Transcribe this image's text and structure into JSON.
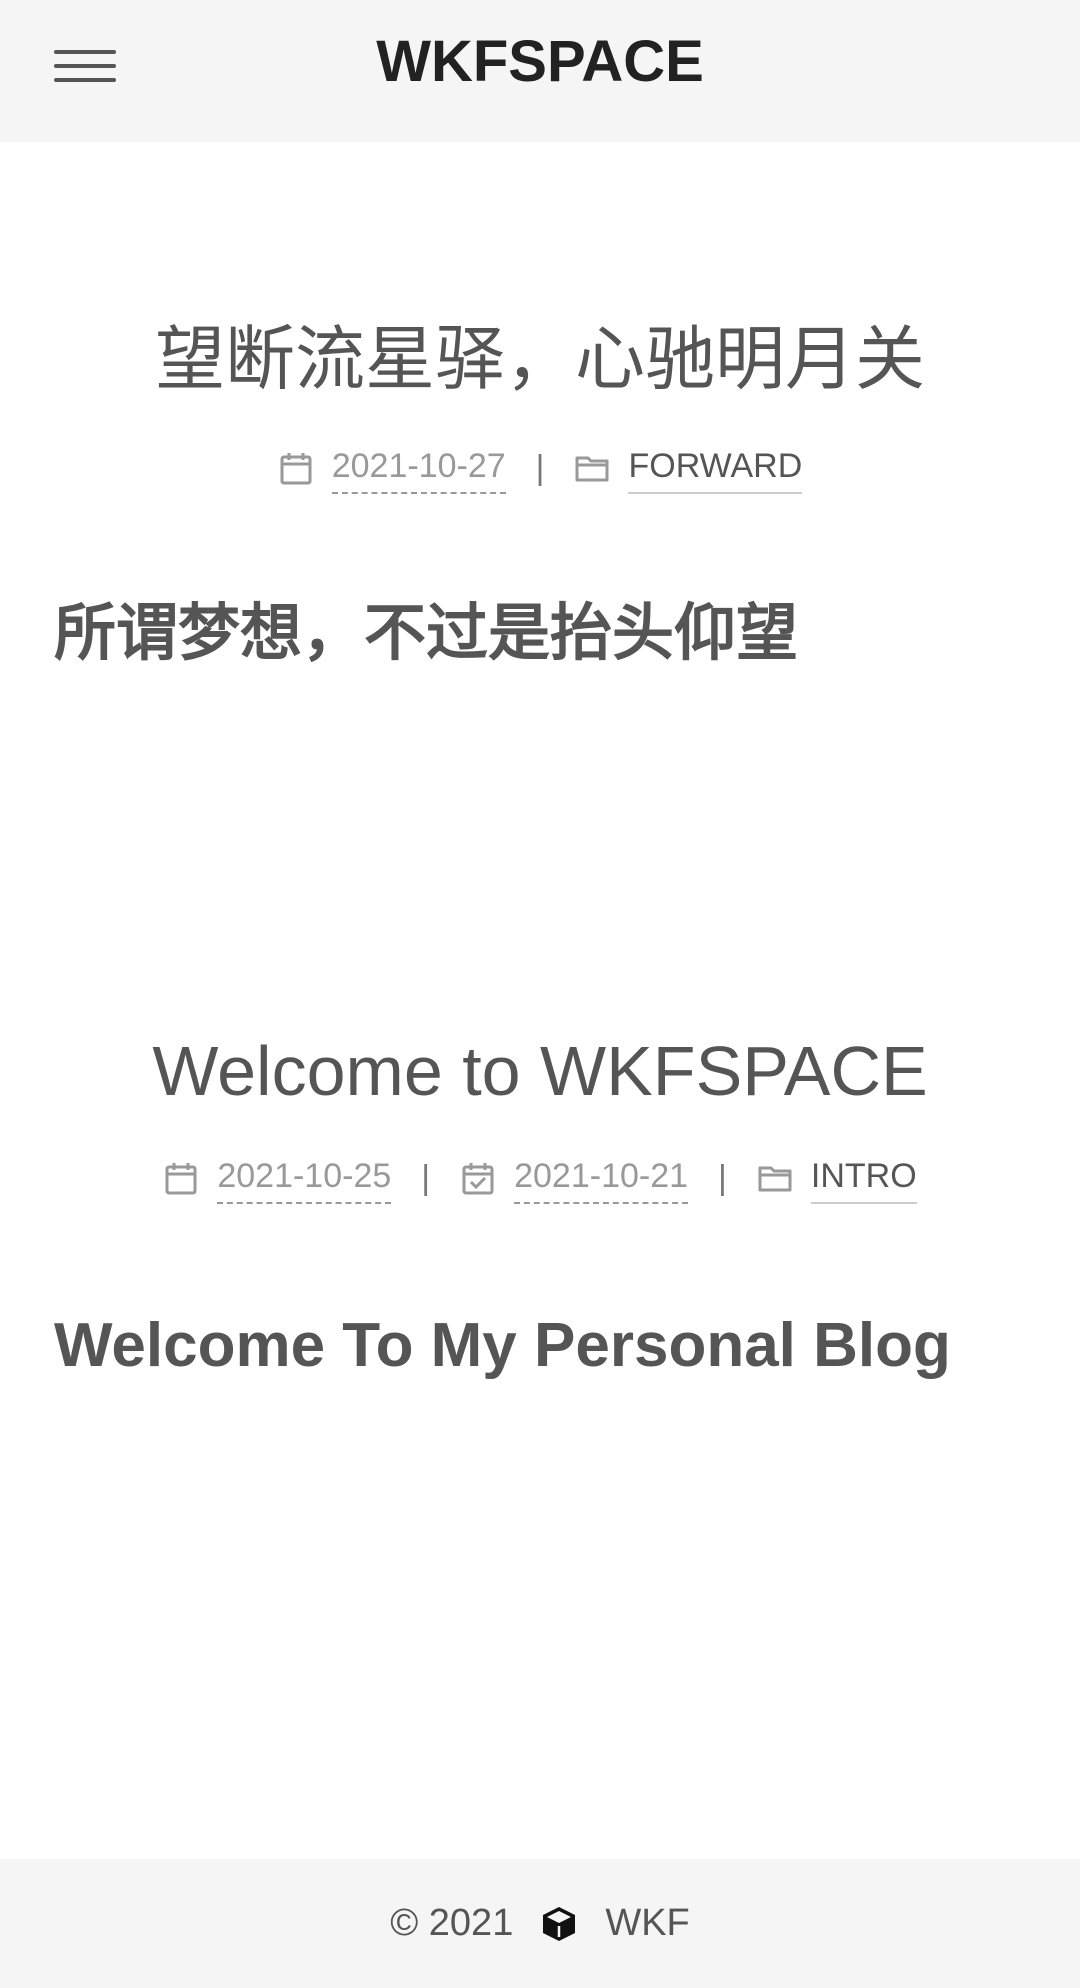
{
  "header": {
    "site_title": "WKFSPACE",
    "menu_icon": "hamburger-menu-icon"
  },
  "posts": [
    {
      "title": "望断流星驿，心驰明月关",
      "meta": {
        "created": "2021-10-27",
        "separator": "|",
        "category": "FORWARD"
      },
      "excerpt": "所谓梦想，不过是抬头仰望"
    },
    {
      "title": "Welcome to WKFSPACE",
      "meta": {
        "created": "2021-10-25",
        "separator": "|",
        "updated": "2021-10-21",
        "category": "INTRO"
      },
      "excerpt": "Welcome To My Personal Blog"
    }
  ],
  "footer": {
    "copyright": "© 2021",
    "icon": "cube-icon",
    "author": "WKF"
  },
  "colors": {
    "header_bg": "#f5f5f5",
    "text": "#555555",
    "title": "#222222",
    "meta": "#999999"
  }
}
